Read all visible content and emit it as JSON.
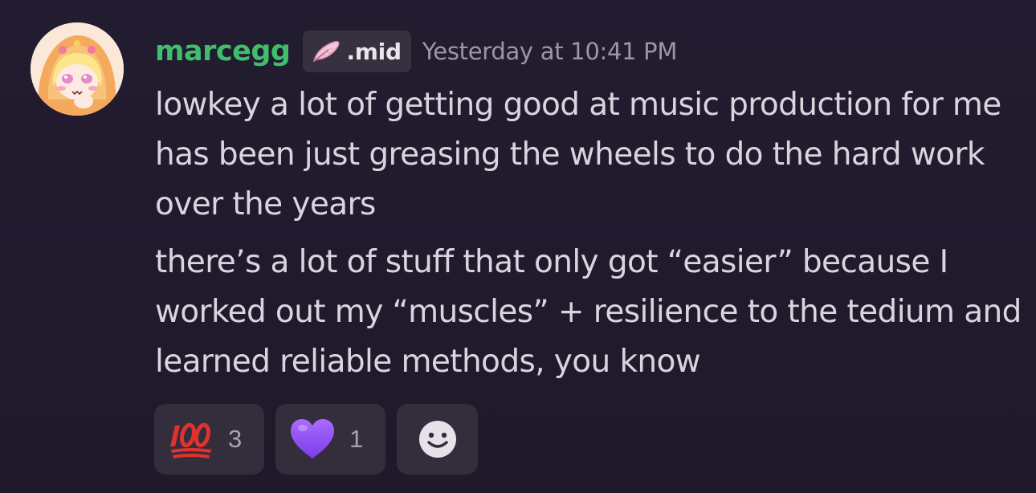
{
  "message": {
    "username": "marcegg",
    "guild_tag": ".mid",
    "timestamp": "Yesterday at 10:41 PM",
    "paragraphs": [
      "lowkey a lot of getting good at music production for me has been just greasing the wheels to do the hard work over the years",
      "there’s a lot of stuff that only got “easier” because I worked out my “muscles” + resilience to the tedium and learned reliable methods, you know"
    ],
    "reactions": [
      {
        "emoji": "hundred-points-icon",
        "count": "3"
      },
      {
        "emoji": "purple-heart-icon",
        "count": "1"
      }
    ],
    "add_reaction_icon": "smiley-icon"
  },
  "colors": {
    "background": "#221c30",
    "username": "#3fbf6c",
    "text": "#d9d4dd",
    "timestamp": "#9d96a6",
    "reaction_bg": "#342e3c",
    "tag_bg": "#37303f"
  }
}
